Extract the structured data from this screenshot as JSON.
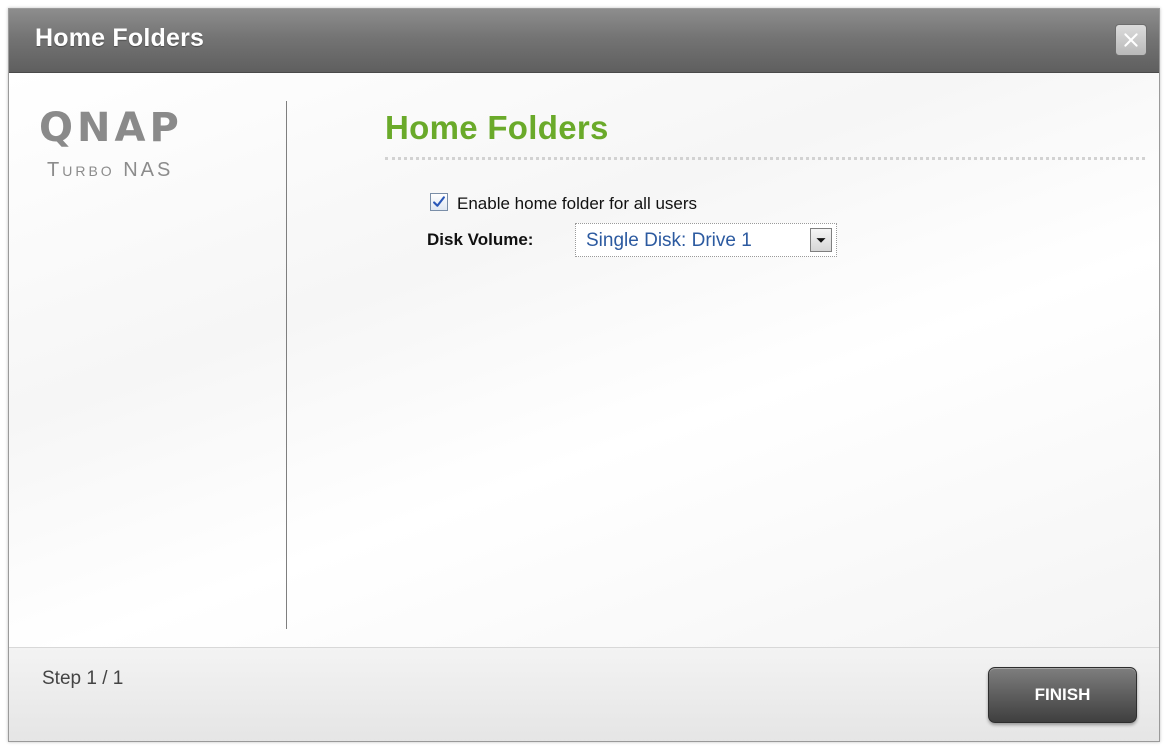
{
  "window": {
    "title": "Home Folders",
    "close_icon": "close-icon"
  },
  "brand": {
    "logo_text": "QNAP",
    "subtitle": "Turbo NAS"
  },
  "main": {
    "title": "Home Folders",
    "enable_checkbox": {
      "label": "Enable home folder for all users",
      "checked": true
    },
    "disk_volume": {
      "label": "Disk Volume:",
      "selected": "Single Disk: Drive 1"
    }
  },
  "footer": {
    "step": "Step 1 / 1",
    "finish_label": "FINISH"
  },
  "colors": {
    "title_green": "#6aaa2a",
    "titlebar": "#747474",
    "select_text": "#2c5aa0"
  }
}
